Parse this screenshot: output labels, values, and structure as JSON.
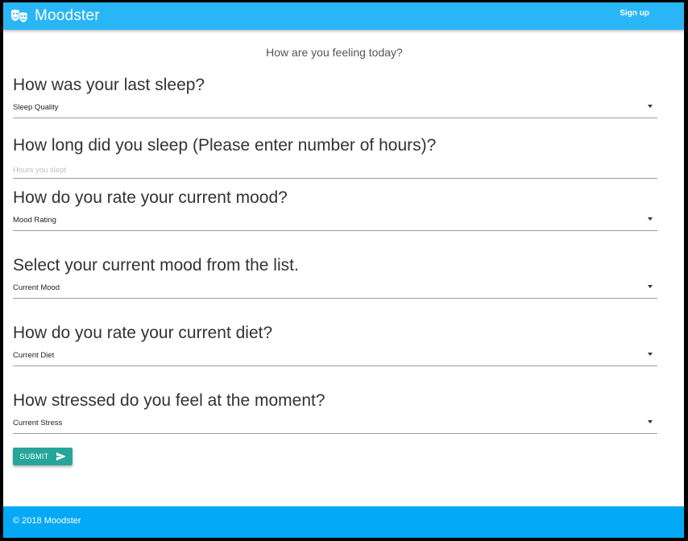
{
  "navbar": {
    "brand": "Moodster",
    "brand_icon": "theater-masks-icon",
    "signup_label": "Sign up",
    "color": "#29b6f6"
  },
  "main": {
    "subtitle": "How are you feeling today?",
    "questions": [
      {
        "title": "How was your last sleep?",
        "type": "select",
        "value": "Sleep Quality"
      },
      {
        "title": "How long did you sleep (Please enter number of hours)?",
        "type": "input",
        "placeholder": "Hours you slept"
      },
      {
        "title": "How do you rate your current mood?",
        "type": "select",
        "value": "Mood Rating"
      },
      {
        "title": "Select your current mood from the list.",
        "type": "select",
        "value": "Current Mood"
      },
      {
        "title": "How do you rate your current diet?",
        "type": "select",
        "value": "Current Diet"
      },
      {
        "title": "How stressed do you feel at the moment?",
        "type": "select",
        "value": "Current Stress"
      }
    ],
    "submit_label": "SUBMIT",
    "submit_icon": "send-icon",
    "submit_color": "#26a69a"
  },
  "footer": {
    "text": "© 2018 Moodster",
    "color": "#03a9f4"
  }
}
